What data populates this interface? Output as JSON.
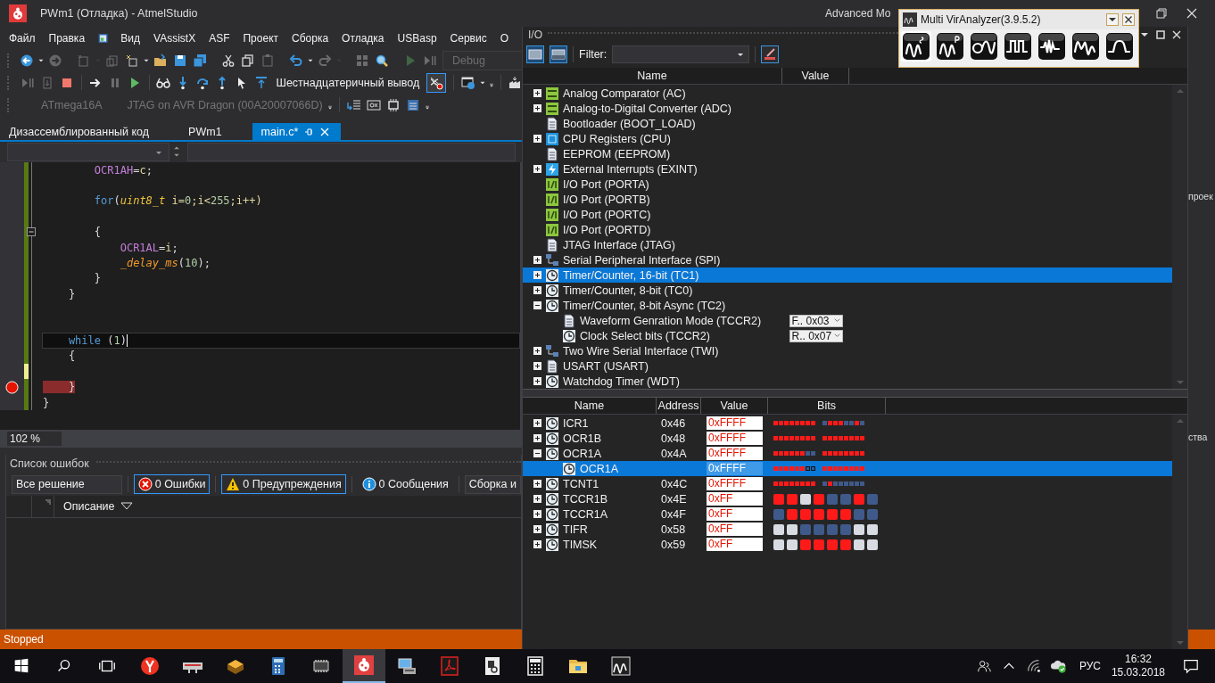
{
  "title_bar": {
    "title": "PWm1 (Отладка) - AtmelStudio",
    "mode_label": "Advanced Mo"
  },
  "menu": [
    {
      "kind": "text",
      "label": "Файл"
    },
    {
      "kind": "text",
      "label": "Правка"
    },
    {
      "kind": "icon"
    },
    {
      "kind": "text",
      "label": "Вид"
    },
    {
      "kind": "text",
      "label": "VAssistX"
    },
    {
      "kind": "text",
      "label": "ASF"
    },
    {
      "kind": "text",
      "label": "Проект"
    },
    {
      "kind": "text",
      "label": "Сборка"
    },
    {
      "kind": "text",
      "label": "Отладка"
    },
    {
      "kind": "text",
      "label": "USBasp"
    },
    {
      "kind": "text",
      "label": "Сервис"
    },
    {
      "kind": "text",
      "label": "О"
    }
  ],
  "toolbars": [
    [
      {
        "kind": "back-arrow",
        "disabled": false
      },
      {
        "kind": "caret",
        "disabled": false
      },
      {
        "kind": "forward-arrow",
        "disabled": true
      },
      {
        "kind": "separator"
      },
      {
        "kind": "new-project",
        "disabled": true
      },
      {
        "kind": "caret",
        "disabled": true
      },
      {
        "kind": "add-file",
        "disabled": true
      },
      {
        "kind": "new-item",
        "disabled": false
      },
      {
        "kind": "caret",
        "disabled": false
      },
      {
        "kind": "open-folder",
        "disabled": false
      },
      {
        "kind": "save",
        "disabled": false
      },
      {
        "kind": "save-all",
        "disabled": false
      },
      {
        "kind": "separator"
      },
      {
        "kind": "scissors",
        "disabled": false
      },
      {
        "kind": "copy",
        "disabled": false
      },
      {
        "kind": "paste",
        "disabled": true
      },
      {
        "kind": "separator"
      },
      {
        "kind": "undo",
        "disabled": false
      },
      {
        "kind": "caret",
        "disabled": false
      },
      {
        "kind": "redo",
        "disabled": true
      },
      {
        "kind": "caret",
        "disabled": true
      },
      {
        "kind": "separator"
      },
      {
        "kind": "grid",
        "disabled": true
      },
      {
        "kind": "magnifier",
        "disabled": false
      },
      {
        "kind": "separator"
      },
      {
        "kind": "play",
        "disabled": true
      },
      {
        "kind": "play-pause",
        "disabled": true
      },
      {
        "kind": "dropdown",
        "label": "Debug",
        "disabled": true
      }
    ],
    [
      {
        "kind": "play-pause",
        "disabled": true
      },
      {
        "kind": "document-arrow",
        "disabled": true
      },
      {
        "kind": "stop",
        "disabled": false
      },
      {
        "kind": "separator"
      },
      {
        "kind": "right-arrow",
        "disabled": false
      },
      {
        "kind": "pause",
        "disabled": true
      },
      {
        "kind": "play",
        "disabled": false
      },
      {
        "kind": "separator"
      },
      {
        "kind": "glasses",
        "disabled": false
      },
      {
        "kind": "step-into",
        "disabled": false
      },
      {
        "kind": "step-over",
        "disabled": false
      },
      {
        "kind": "step-out",
        "disabled": false
      },
      {
        "kind": "cursor",
        "disabled": false
      },
      {
        "kind": "align-top",
        "disabled": false
      },
      {
        "kind": "text-button",
        "label": "Шестнадцатеричный вывод",
        "disabled": false
      },
      {
        "kind": "toggle",
        "checked": true
      },
      {
        "kind": "separator"
      },
      {
        "kind": "window",
        "disabled": false
      },
      {
        "kind": "caret",
        "disabled": false
      },
      {
        "kind": "overflow",
        "disabled": false
      },
      {
        "kind": "separator"
      },
      {
        "kind": "factory",
        "disabled": false
      }
    ],
    [
      {
        "kind": "device",
        "label": "ATmega16A",
        "disabled": true
      },
      {
        "kind": "tool",
        "label": "JTAG on AVR Dragon (00A20007066D)",
        "disabled": true
      },
      {
        "kind": "overflow",
        "disabled": false
      },
      {
        "kind": "separator"
      },
      {
        "kind": "list-arrow",
        "disabled": false
      },
      {
        "kind": "hex",
        "disabled": false
      },
      {
        "kind": "chip",
        "disabled": false
      },
      {
        "kind": "memory",
        "disabled": false
      },
      {
        "kind": "overflow",
        "disabled": false
      }
    ]
  ],
  "document_tabs": [
    {
      "label": "Дизассемблированный код",
      "selected": false
    },
    {
      "label": "PWm1",
      "selected": false
    },
    {
      "label": "main.c*",
      "selected": true
    }
  ],
  "editor": {
    "zoom": "102 %",
    "lines": [
      {
        "tokens": [
          {
            "text": "        OCR1AH",
            "kind": "macro"
          },
          {
            "text": "=",
            "kind": "plain"
          },
          {
            "text": "c",
            "kind": "variable"
          },
          {
            "text": ";",
            "kind": "plain"
          }
        ],
        "current": false,
        "breakpoint": false,
        "modified": false,
        "foldable": false
      },
      {
        "current": false,
        "breakpoint": false,
        "modified": false,
        "foldable": false
      },
      {
        "tokens": [
          {
            "text": "        for",
            "kind": "keyword"
          },
          {
            "text": "(",
            "kind": "plain"
          },
          {
            "text": "uint8_t",
            "kind": "type"
          },
          {
            "text": " i=",
            "kind": "variable"
          },
          {
            "text": "0",
            "kind": "number"
          },
          {
            "text": ";i<",
            "kind": "variable"
          },
          {
            "text": "255",
            "kind": "number"
          },
          {
            "text": ";i++)",
            "kind": "variable"
          }
        ],
        "current": false,
        "breakpoint": false,
        "modified": false,
        "foldable": false
      },
      {
        "current": false,
        "breakpoint": false,
        "modified": false,
        "foldable": false
      },
      {
        "tokens": [
          {
            "text": "        {",
            "kind": "plain"
          }
        ],
        "current": false,
        "breakpoint": false,
        "modified": false,
        "foldable": true
      },
      {
        "tokens": [
          {
            "text": "            OCR1AL",
            "kind": "macro"
          },
          {
            "text": "=",
            "kind": "plain"
          },
          {
            "text": "i",
            "kind": "variable"
          },
          {
            "text": ";",
            "kind": "plain"
          }
        ],
        "current": false,
        "breakpoint": false,
        "modified": false,
        "foldable": false
      },
      {
        "tokens": [
          {
            "text": "            _delay_ms",
            "kind": "function"
          },
          {
            "text": "(",
            "kind": "plain"
          },
          {
            "text": "10",
            "kind": "number"
          },
          {
            "text": ");",
            "kind": "plain"
          }
        ],
        "current": false,
        "breakpoint": false,
        "modified": false,
        "foldable": false
      },
      {
        "tokens": [
          {
            "text": "        }",
            "kind": "plain"
          }
        ],
        "current": false,
        "breakpoint": false,
        "modified": false,
        "foldable": false
      },
      {
        "tokens": [
          {
            "text": "    }",
            "kind": "plain"
          }
        ],
        "current": false,
        "breakpoint": false,
        "modified": false,
        "foldable": false
      },
      {
        "current": false,
        "breakpoint": false,
        "modified": false,
        "foldable": false
      },
      {
        "current": false,
        "breakpoint": false,
        "modified": false,
        "foldable": false
      },
      {
        "tokens": [
          {
            "text": "    while",
            "kind": "keyword"
          },
          {
            "text": " (",
            "kind": "plain"
          },
          {
            "text": "1",
            "kind": "number"
          },
          {
            "text": ")",
            "kind": "plain"
          }
        ],
        "current": true,
        "breakpoint": false,
        "modified": false,
        "foldable": false
      },
      {
        "tokens": [
          {
            "text": "    {",
            "kind": "plain"
          }
        ],
        "current": false,
        "breakpoint": false,
        "modified": false,
        "foldable": false
      },
      {
        "current": false,
        "breakpoint": false,
        "modified": true,
        "foldable": false
      },
      {
        "tokens": [
          {
            "text": "    }",
            "kind": "plain"
          }
        ],
        "current": false,
        "breakpoint": true,
        "modified": false,
        "foldable": false
      },
      {
        "tokens": [
          {
            "text": "}",
            "kind": "plain"
          }
        ],
        "current": false,
        "breakpoint": false,
        "modified": false,
        "foldable": false
      }
    ]
  },
  "error_list": {
    "title": "Список ошибок",
    "scope": "Все решение",
    "filters": [
      {
        "kind": "error",
        "label": "0 Ошибки",
        "selected": true
      },
      {
        "kind": "warning",
        "label": "0 Предупреждения",
        "selected": true
      },
      {
        "kind": "info",
        "label": "0 Сообщения",
        "selected": false
      }
    ],
    "source": "Сборка и",
    "columns": [
      "Описание"
    ]
  },
  "status_bar": {
    "text": "Stopped"
  },
  "io_window": {
    "title": "I/O",
    "filter_label": "Filter:",
    "tree_columns": [
      "Name",
      "Value"
    ],
    "tree": [
      {
        "kind": "adc",
        "name": "Analog Comparator (AC)",
        "expanded": false,
        "selected": false
      },
      {
        "kind": "adc",
        "name": "Analog-to-Digital Converter (ADC)",
        "expanded": false,
        "selected": false
      },
      {
        "kind": "doc",
        "name": "Bootloader (BOOT_LOAD)",
        "selected": false
      },
      {
        "kind": "cpu",
        "name": "CPU Registers (CPU)",
        "expanded": false,
        "selected": false
      },
      {
        "kind": "doc",
        "name": "EEPROM (EEPROM)",
        "selected": false
      },
      {
        "kind": "interrupt",
        "name": "External Interrupts (EXINT)",
        "expanded": false,
        "selected": false
      },
      {
        "kind": "port",
        "name": "I/O Port (PORTA)",
        "selected": false
      },
      {
        "kind": "port",
        "name": "I/O Port (PORTB)",
        "selected": false
      },
      {
        "kind": "port",
        "name": "I/O Port (PORTC)",
        "selected": false
      },
      {
        "kind": "port",
        "name": "I/O Port (PORTD)",
        "selected": false
      },
      {
        "kind": "doc",
        "name": "JTAG Interface (JTAG)",
        "selected": false
      },
      {
        "kind": "bus",
        "name": "Serial Peripheral Interface (SPI)",
        "expanded": false,
        "selected": false
      },
      {
        "kind": "timer",
        "name": "Timer/Counter, 16-bit (TC1)",
        "expanded": false,
        "selected": true
      },
      {
        "kind": "timer",
        "name": "Timer/Counter, 8-bit (TC0)",
        "expanded": false,
        "selected": false
      },
      {
        "kind": "timer",
        "name": "Timer/Counter, 8-bit Async (TC2)",
        "expanded": true,
        "selected": false,
        "children": [
          {
            "kind": "doc",
            "name": "Waveform Genration Mode (TCCR2)",
            "value": "F.. 0x03",
            "selected": false
          },
          {
            "kind": "timer",
            "name": "Clock Select bits (TCCR2)",
            "value": "R.. 0x07",
            "selected": false
          }
        ]
      },
      {
        "kind": "bus",
        "name": "Two Wire Serial Interface (TWI)",
        "expanded": false,
        "selected": false
      },
      {
        "kind": "doc",
        "name": "USART (USART)",
        "expanded": false,
        "selected": false
      },
      {
        "kind": "timer",
        "name": "Watchdog Timer (WDT)",
        "expanded": false,
        "selected": false
      }
    ],
    "register_columns": [
      "Name",
      "Address",
      "Value",
      "Bits"
    ],
    "registers": [
      {
        "name": "ICR1",
        "address": "0x46",
        "value": "0xFFFF",
        "bits": [
          {
            "set": true
          },
          {
            "set": true
          },
          {
            "set": true
          },
          {
            "set": true
          },
          {
            "set": true
          },
          {
            "set": true
          },
          {
            "set": true
          },
          {
            "set": true
          },
          {
            "set": false
          },
          {
            "set": true
          },
          {
            "set": true
          },
          {
            "set": true
          },
          {
            "set": false
          },
          {
            "set": false
          },
          {
            "set": true
          },
          {
            "set": false
          }
        ],
        "expanded": false,
        "selected": false
      },
      {
        "name": "OCR1B",
        "address": "0x48",
        "value": "0xFFFF",
        "bits": [
          {
            "set": true
          },
          {
            "set": true
          },
          {
            "set": true
          },
          {
            "set": true
          },
          {
            "set": true
          },
          {
            "set": true
          },
          {
            "set": true
          },
          {
            "set": true
          },
          {
            "set": true
          },
          {
            "set": true
          },
          {
            "set": true
          },
          {
            "set": true
          },
          {
            "set": true
          },
          {
            "set": true
          },
          {
            "set": true
          },
          {
            "set": true
          }
        ],
        "expanded": false,
        "selected": false
      },
      {
        "name": "OCR1A",
        "address": "0x4A",
        "value": "0xFFFF",
        "bits": [
          {
            "set": true
          },
          {
            "set": true
          },
          {
            "set": true
          },
          {
            "set": true
          },
          {
            "set": true
          },
          {
            "set": true
          },
          {
            "set": false
          },
          {
            "set": false
          },
          {
            "set": true
          },
          {
            "set": true
          },
          {
            "set": true
          },
          {
            "set": true
          },
          {
            "set": true
          },
          {
            "set": true
          },
          {
            "set": true
          },
          {
            "set": true
          }
        ],
        "expanded": true,
        "selected": false,
        "children": [
          {
            "name": "OCR1A",
            "value": "0xFFFF",
            "bits": [
              {
                "set": true
              },
              {
                "set": true
              },
              {
                "set": true
              },
              {
                "set": true
              },
              {
                "set": true
              },
              {
                "set": true
              },
              {
                "set": false
              },
              {
                "set": false
              },
              {
                "set": true
              },
              {
                "set": true
              },
              {
                "set": true
              },
              {
                "set": true
              },
              {
                "set": true
              },
              {
                "set": true
              },
              {
                "set": true
              },
              {
                "set": true
              }
            ],
            "selected": true
          }
        ]
      },
      {
        "name": "TCNT1",
        "address": "0x4C",
        "value": "0xFFFF",
        "bits": [
          {
            "set": true
          },
          {
            "set": true
          },
          {
            "set": true
          },
          {
            "set": true
          },
          {
            "set": true
          },
          {
            "set": true
          },
          {
            "set": true
          },
          {
            "set": true
          },
          {
            "set": false
          },
          {
            "set": true
          },
          {
            "set": false
          },
          {
            "set": false
          },
          {
            "set": false
          },
          {
            "set": false
          },
          {
            "set": false
          },
          {
            "set": false
          }
        ],
        "expanded": false,
        "selected": false
      },
      {
        "name": "TCCR1B",
        "address": "0x4E",
        "value": "0xFF",
        "bits": [
          {
            "set": true
          },
          {
            "set": true
          },
          {
            "reserved": true
          },
          {
            "set": true
          },
          {
            "set": false
          },
          {
            "set": false
          },
          {
            "set": true
          },
          {
            "set": false
          }
        ],
        "expanded": false,
        "selected": false
      },
      {
        "name": "TCCR1A",
        "address": "0x4F",
        "value": "0xFF",
        "bits": [
          {
            "set": false
          },
          {
            "set": true
          },
          {
            "set": true
          },
          {
            "set": true
          },
          {
            "set": true
          },
          {
            "set": true
          },
          {
            "set": false
          },
          {
            "set": false
          }
        ],
        "expanded": false,
        "selected": false
      },
      {
        "name": "TIFR",
        "address": "0x58",
        "value": "0xFF",
        "bits": [
          {
            "reserved": true
          },
          {
            "reserved": true
          },
          {
            "set": false
          },
          {
            "set": false
          },
          {
            "set": false
          },
          {
            "set": false
          },
          {
            "reserved": true
          },
          {
            "reserved": true
          }
        ],
        "expanded": false,
        "selected": false
      },
      {
        "name": "TIMSK",
        "address": "0x59",
        "value": "0xFF",
        "bits": [
          {
            "reserved": true
          },
          {
            "reserved": true
          },
          {
            "set": true
          },
          {
            "set": true
          },
          {
            "set": true
          },
          {
            "set": true
          },
          {
            "reserved": true
          },
          {
            "reserved": true
          }
        ],
        "expanded": false,
        "selected": false
      }
    ]
  },
  "analyzer_window": {
    "title": "Multi VirAnalyzer(3.9.5.2)",
    "tools": [
      {
        "kind": "wave-s",
        "selected": true
      },
      {
        "kind": "wave-p",
        "selected": false
      },
      {
        "kind": "probe",
        "selected": false
      },
      {
        "kind": "square",
        "selected": false
      },
      {
        "kind": "burst",
        "selected": false
      },
      {
        "kind": "wave",
        "selected": false
      },
      {
        "kind": "pulse",
        "selected": false
      }
    ]
  },
  "side_strip": {
    "texts": [
      "проек",
      "ства"
    ]
  },
  "taskbar": {
    "apps": [
      {
        "kind": "y-circle",
        "selected": false
      },
      {
        "kind": "router",
        "selected": false
      },
      {
        "kind": "chip-box",
        "selected": false
      },
      {
        "kind": "calculator",
        "selected": false
      },
      {
        "kind": "ic-chip",
        "selected": false
      },
      {
        "kind": "ladybug",
        "selected": true
      },
      {
        "kind": "computer",
        "selected": false
      },
      {
        "kind": "pdf",
        "selected": false
      },
      {
        "kind": "document-viewer",
        "selected": false
      },
      {
        "kind": "calculator-grid",
        "selected": false
      },
      {
        "kind": "folder",
        "selected": false
      },
      {
        "kind": "waveform",
        "selected": false
      }
    ],
    "language": "РУС",
    "time": "16:32",
    "date": "15.03.2018"
  }
}
